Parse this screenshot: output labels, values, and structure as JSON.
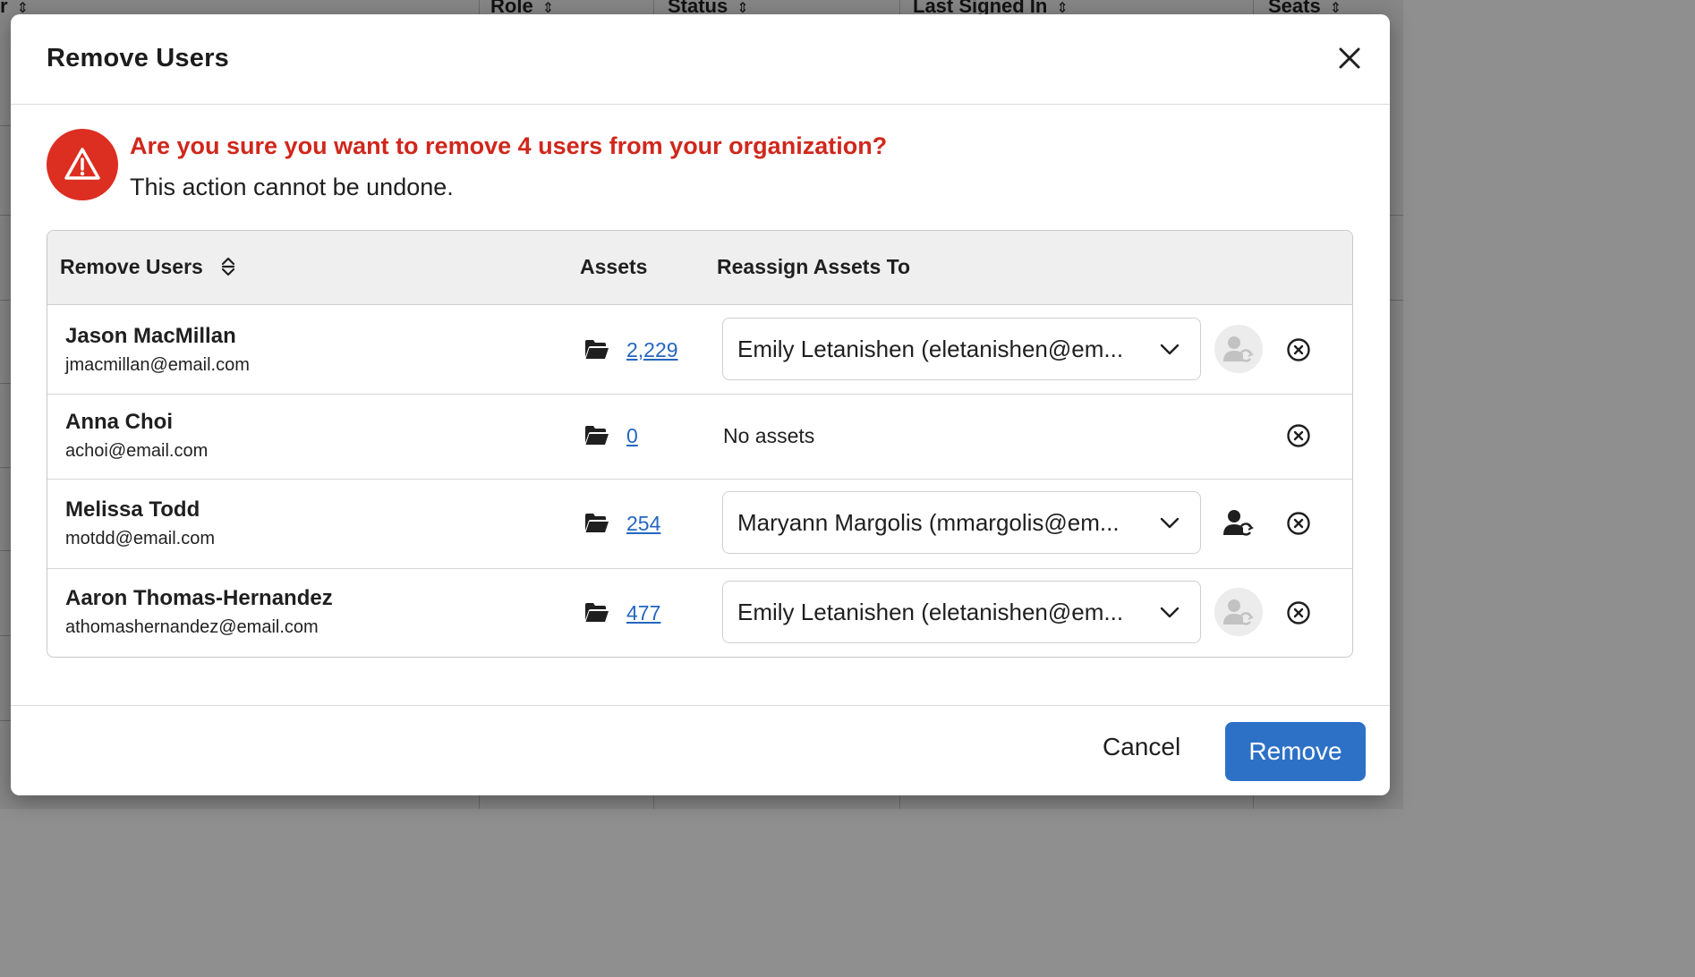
{
  "background": {
    "columns": [
      {
        "label": "r"
      },
      {
        "label": "Role"
      },
      {
        "label": "Status"
      },
      {
        "label": "Last Signed In"
      },
      {
        "label": "Seats"
      }
    ]
  },
  "dialog": {
    "title": "Remove Users",
    "warning": {
      "question": "Are you sure you want to remove 4 users from your organization?",
      "subtext": "This action cannot be undone."
    },
    "table": {
      "headers": {
        "users": "Remove Users",
        "assets": "Assets",
        "reassign": "Reassign Assets To"
      },
      "rows": [
        {
          "name": "Jason MacMillan",
          "email": "jmacmillan@email.com",
          "assets": "2,229",
          "reassign_to": "Emily Letanishen (eletanishen@em...",
          "reassign_enabled": false
        },
        {
          "name": "Anna Choi",
          "email": "achoi@email.com",
          "assets": "0",
          "no_assets_text": "No assets"
        },
        {
          "name": "Melissa Todd",
          "email": "motdd@email.com",
          "assets": "254",
          "reassign_to": "Maryann Margolis (mmargolis@em...",
          "reassign_enabled": true
        },
        {
          "name": "Aaron Thomas-Hernandez",
          "email": "athomashernandez@email.com",
          "assets": "477",
          "reassign_to": "Emily Letanishen (eletanishen@em...",
          "reassign_enabled": false
        }
      ]
    },
    "footer": {
      "cancel_label": "Cancel",
      "remove_label": "Remove"
    }
  },
  "colors": {
    "danger": "#dd2e22",
    "link": "#2466c0",
    "primary": "#2d71c6"
  },
  "icons": {
    "close": "close-icon",
    "warning": "warning-triangle-icon",
    "sort": "sort-icon",
    "folder": "folder-open-icon",
    "chevron": "chevron-down-icon",
    "reassign": "user-reassign-icon",
    "remove_row": "circle-x-icon"
  }
}
